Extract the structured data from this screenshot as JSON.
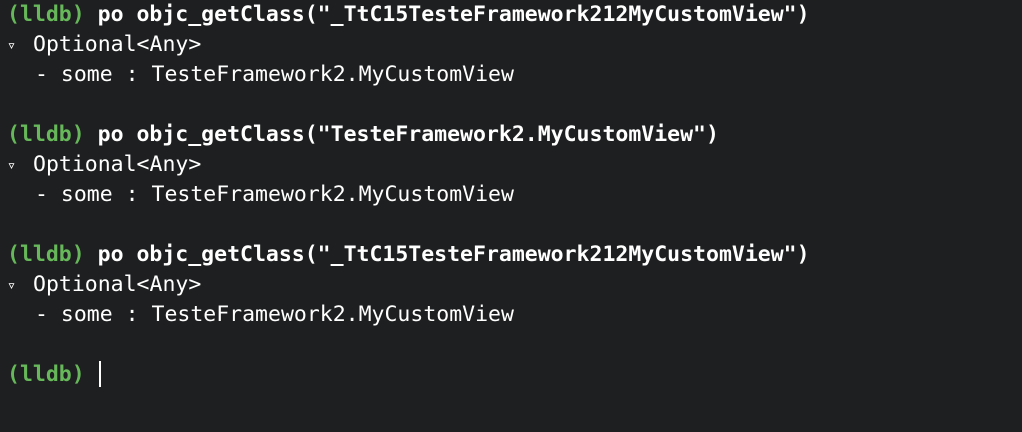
{
  "console": {
    "prompt": "(lldb)",
    "blocks": [
      {
        "command": "po objc_getClass(\"_TtC15TesteFramework212MyCustomView\")",
        "disclosure": "▿",
        "result_type": "Optional<Any>",
        "child": "- some : TesteFramework2.MyCustomView"
      },
      {
        "command": "po objc_getClass(\"TesteFramework2.MyCustomView\")",
        "disclosure": "▿",
        "result_type": "Optional<Any>",
        "child": "- some : TesteFramework2.MyCustomView"
      },
      {
        "command": "po objc_getClass(\"_TtC15TesteFramework212MyCustomView\")",
        "disclosure": "▿",
        "result_type": "Optional<Any>",
        "child": "- some : TesteFramework2.MyCustomView"
      }
    ],
    "colors": {
      "background": "#1e1f20",
      "prompt": "#67b85a",
      "text": "#ffffff"
    }
  }
}
